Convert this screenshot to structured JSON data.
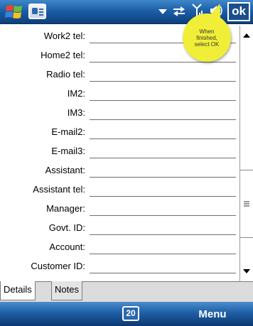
{
  "titlebar": {
    "icons": [
      "windows-start-icon",
      "contact-card-icon",
      "dropdown-arrow-icon",
      "connectivity-icon",
      "signal-icon",
      "volume-icon"
    ],
    "ok_label": "ok"
  },
  "balloon": {
    "lines": [
      "When",
      "finished,",
      "select OK"
    ]
  },
  "fields": [
    {
      "label": "Work2 tel:",
      "value": ""
    },
    {
      "label": "Home2 tel:",
      "value": ""
    },
    {
      "label": "Radio tel:",
      "value": ""
    },
    {
      "label": "IM2:",
      "value": ""
    },
    {
      "label": "IM3:",
      "value": ""
    },
    {
      "label": "E-mail2:",
      "value": ""
    },
    {
      "label": "E-mail3:",
      "value": ""
    },
    {
      "label": "Assistant:",
      "value": ""
    },
    {
      "label": "Assistant tel:",
      "value": ""
    },
    {
      "label": "Manager:",
      "value": ""
    },
    {
      "label": "Govt. ID:",
      "value": ""
    },
    {
      "label": "Account:",
      "value": ""
    },
    {
      "label": "Customer ID:",
      "value": ""
    }
  ],
  "tabs": [
    {
      "label": "Details",
      "active": true
    },
    {
      "label": "Notes",
      "active": false
    }
  ],
  "softkeys": {
    "input_indicator": "20",
    "menu_label": "Menu"
  },
  "colors": {
    "titlebar": "#1c5fa8",
    "balloon": "#f1ee38",
    "softkey_bar": "#1f5fa6"
  }
}
